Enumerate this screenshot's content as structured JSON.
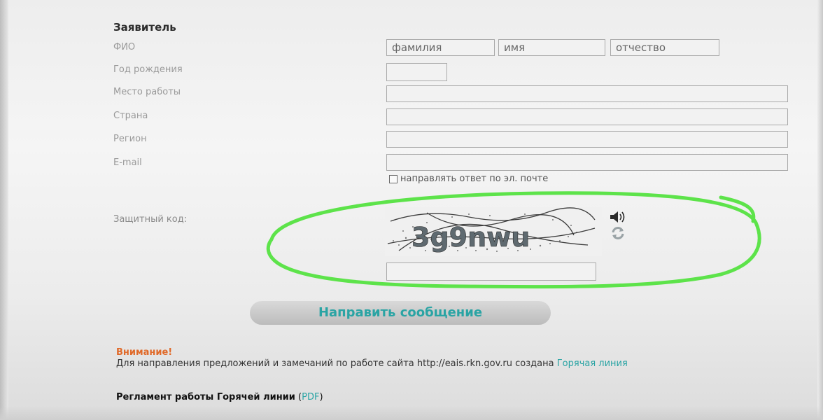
{
  "form": {
    "section_title": "Заявитель",
    "fields": {
      "fio_label": "ФИО",
      "surname_placeholder": "фамилия",
      "name_placeholder": "имя",
      "patronymic_placeholder": "отчество",
      "birth_year_label": "Год рождения",
      "workplace_label": "Место работы",
      "country_label": "Страна",
      "region_label": "Регион",
      "email_label": "E-mail"
    },
    "email_reply_checkbox_label": "направлять ответ по эл. почте",
    "captcha_label": "Защитный код:",
    "captcha_text": "3g9nwu",
    "submit_label": "Направить сообщение"
  },
  "notice": {
    "heading": "Внимание!",
    "text": "Для направления предложений и замечаний по работе сайта http://eais.rkn.gov.ru создана ",
    "link_text": "Горячая линия"
  },
  "rules": {
    "text": "Регламент работы Горячей линии",
    "open_paren": " (",
    "pdf_link": "PDF",
    "close_paren": ")"
  },
  "colors": {
    "accent_teal": "#2aa4a4",
    "warning_orange": "#e06a2a",
    "highlight_green": "#5de34a"
  },
  "icons": {
    "audio": "speaker-icon",
    "refresh": "refresh-icon"
  }
}
